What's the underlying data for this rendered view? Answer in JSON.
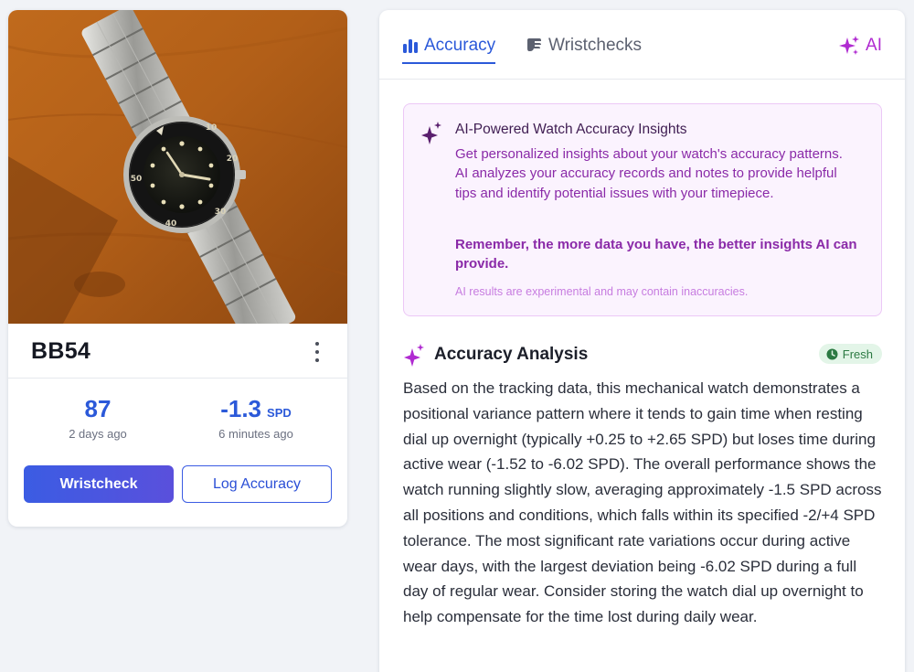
{
  "watch": {
    "name": "BB54",
    "stats": [
      {
        "value": "87",
        "unit": "",
        "label": "2 days ago"
      },
      {
        "value": "-1.3",
        "unit": "SPD",
        "label": "6 minutes ago"
      }
    ],
    "wristcheck_button": "Wristcheck",
    "log_button": "Log Accuracy"
  },
  "tabs": {
    "accuracy": "Accuracy",
    "wristchecks": "Wristchecks",
    "ai": "AI"
  },
  "info": {
    "title": "AI-Powered Watch Accuracy Insights",
    "description": "Get personalized insights about your watch's accuracy patterns. AI analyzes your accuracy records and notes to provide helpful tips and identify potential issues with your timepiece.",
    "emphasis": "Remember, the more data you have, the better insights AI can provide.",
    "note": "AI results are experimental and may contain inaccuracies."
  },
  "analysis": {
    "title": "Accuracy Analysis",
    "badge": "Fresh",
    "body": "Based on the tracking data, this mechanical watch demonstrates a positional variance pattern where it tends to gain time when resting dial up overnight (typically +0.25 to +2.65 SPD) but loses time during active wear (-1.52 to -6.02 SPD). The overall performance shows the watch running slightly slow, averaging approximately -1.5 SPD across all positions and conditions, which falls within its specified -2/+4 SPD tolerance. The most significant rate variations occur during active wear days, with the largest deviation being -6.02 SPD during a full day of regular wear. Consider storing the watch dial up overnight to help compensate for the time lost during daily wear."
  },
  "colors": {
    "accent": "#2b59d9",
    "ai_purple": "#b02bd1",
    "fresh_green": "#2c7a43"
  }
}
